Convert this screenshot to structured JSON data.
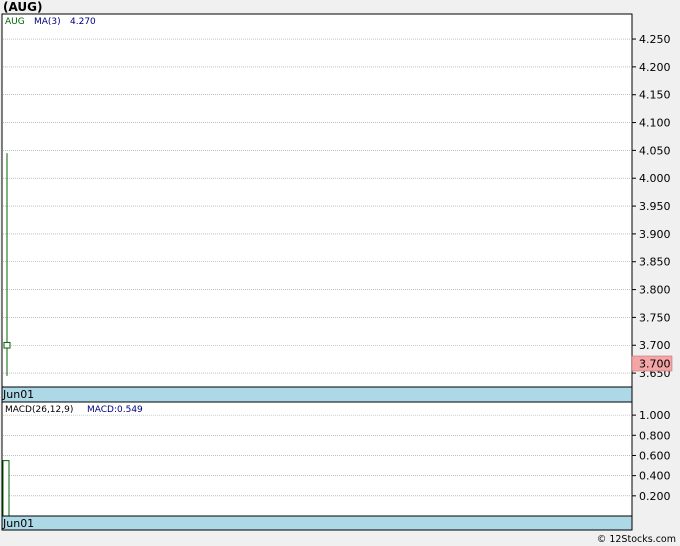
{
  "header": {
    "ticker": "(AUG)"
  },
  "footer": {
    "credit": "© 12Stocks.com"
  },
  "colors": {
    "panel_bg": "#ffffff",
    "page_bg": "#f0f0f0",
    "date_bar": "#add8e6",
    "price_line": "#006400",
    "ma_text": "#000080",
    "price_label_bg": "#f4a6a6",
    "grid": "#9a9a9a"
  },
  "price_panel": {
    "legend_symbol": "AUG",
    "legend_ma": "MA(3)",
    "legend_ma_value": "4.270",
    "date_label": "Jun01",
    "last_price_label": "3.700"
  },
  "macd_panel": {
    "legend_params": "MACD(26,12,9)",
    "legend_value": "MACD:0.549",
    "date_label": "Jun01"
  },
  "chart_data": [
    {
      "type": "line",
      "title": "AUG",
      "x": [
        "Jun01"
      ],
      "series": [
        {
          "name": "AUG",
          "type": "candlestick",
          "open": [
            3.695
          ],
          "high": [
            4.045
          ],
          "low": [
            3.645
          ],
          "close": [
            3.705
          ]
        }
      ],
      "ylim": [
        3.625,
        4.295
      ],
      "yticks": [
        3.65,
        3.7,
        3.75,
        3.8,
        3.85,
        3.9,
        3.95,
        4.0,
        4.05,
        4.1,
        4.15,
        4.2,
        4.25
      ],
      "ytick_labels": [
        "3.650",
        "3.700",
        "3.750",
        "3.800",
        "3.850",
        "3.900",
        "3.950",
        "4.000",
        "4.050",
        "4.100",
        "4.150",
        "4.200",
        "4.250"
      ],
      "last_price": 3.7,
      "grid": true
    },
    {
      "type": "bar",
      "title": "MACD(26,12,9)",
      "x": [
        "Jun01"
      ],
      "series": [
        {
          "name": "MACD",
          "values": [
            0.549
          ]
        }
      ],
      "ylim": [
        0.0,
        1.13
      ],
      "yticks": [
        0.2,
        0.4,
        0.6,
        0.8,
        1.0
      ],
      "ytick_labels": [
        "0.200",
        "0.400",
        "0.600",
        "0.800",
        "1.000"
      ],
      "grid": true
    }
  ]
}
